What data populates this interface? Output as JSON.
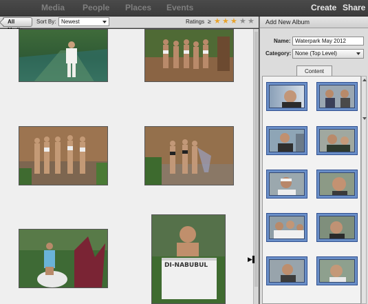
{
  "topnav": {
    "tabs": [
      "Media",
      "People",
      "Places",
      "Events"
    ],
    "actions": [
      "Create",
      "Share"
    ]
  },
  "toolbar": {
    "back_label": "All Media",
    "sort_label": "Sort By:",
    "sort_value": "Newest",
    "ratings_label": "Ratings",
    "ratings_op": "≥",
    "ratings_value": 3,
    "ratings_max": 5
  },
  "panel": {
    "title": "Add New Album",
    "name_label": "Name:",
    "name_value": "Waterpark May 2012",
    "category_label": "Category:",
    "category_value": "None (Top Level)",
    "content_tab": "Content"
  },
  "colors": {
    "star_on": "#e8a22a",
    "star_off": "#8c8c8c",
    "selection_border": "#2e4e8f"
  },
  "icons": {
    "collapse": "collapse-panel-icon",
    "sort_dropdown": "chevron-down-icon",
    "category_dropdown": "chevron-down-icon"
  }
}
